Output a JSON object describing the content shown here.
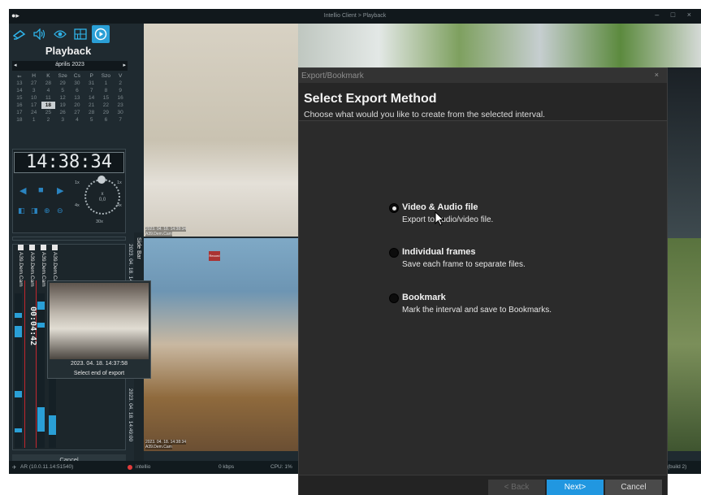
{
  "window": {
    "title": "Intellio Client > Playback",
    "controls": "–  □  ×"
  },
  "left_panel": {
    "toolbar_icons": [
      "camera-icon",
      "speaker-icon",
      "eye-icon",
      "layout-icon",
      "playback-icon"
    ],
    "title": "Playback",
    "calendar": {
      "month": "április 2023",
      "prev": "◂",
      "next": "▸",
      "weekdays": [
        "⇐",
        "H",
        "K",
        "Sze",
        "Cs",
        "P",
        "Szo",
        "V"
      ],
      "rows": [
        [
          "13",
          "27",
          "28",
          "29",
          "30",
          "31",
          "1",
          "2"
        ],
        [
          "14",
          "3",
          "4",
          "5",
          "6",
          "7",
          "8",
          "9"
        ],
        [
          "15",
          "10",
          "11",
          "12",
          "13",
          "14",
          "15",
          "16"
        ],
        [
          "16",
          "17",
          "18",
          "19",
          "20",
          "21",
          "22",
          "23"
        ],
        [
          "17",
          "24",
          "25",
          "26",
          "27",
          "28",
          "29",
          "30"
        ],
        [
          "18",
          "1",
          "2",
          "3",
          "4",
          "5",
          "6",
          "7"
        ]
      ],
      "selected_day": "18"
    },
    "time": "14:38:34",
    "speed": {
      "center": "x 0,0",
      "labels": [
        "1x",
        "1x",
        "4x",
        "4x",
        "30x"
      ]
    },
    "cameras": [
      "A39.Dem.Cam",
      "A39.Dem.Cam",
      "A39.Dem.Cam",
      "A39.Dem.Cam"
    ],
    "duration": "00:04:42",
    "cancel_label": "Cancel"
  },
  "preview": {
    "timestamp": "2023. 04. 18. 14:37:58",
    "hint": "Select end of export"
  },
  "video": {
    "sidebar_label": "Side Bar",
    "cam1_ts": "2023. 04. 18. 14:38:34",
    "cam1_name": "A39.Dem.Cam",
    "cam1_vertical_ts": "2023. 04. 18. 14:28:00",
    "cam2_ts": "2023. 04. 18. 14:38:34",
    "cam2_name": "A39.Dem.Cam",
    "cam2_vertical_ts": "2023. 04. 18. 14:49:00",
    "cam2_badge": "Record"
  },
  "status_bar": {
    "connection": "AR (10.0.11.14:51540)",
    "server": "intellio",
    "bandwidth": "0 kbps",
    "cpu": "CPU: 1%",
    "version": "5.3 (build 2)"
  },
  "dialog": {
    "title": "Export/Bookmark",
    "close": "×",
    "heading": "Select Export Method",
    "subtitle": "Choose what would you like to create from the selected interval.",
    "options": [
      {
        "label": "Video & Audio file",
        "desc": "Export to audio/video file.",
        "selected": true
      },
      {
        "label": "Individual frames",
        "desc": "Save each frame to separate files.",
        "selected": false
      },
      {
        "label": "Bookmark",
        "desc": "Mark the interval and save to Bookmarks.",
        "selected": false
      }
    ],
    "buttons": {
      "back": "< Back",
      "next": "Next>",
      "cancel": "Cancel"
    }
  }
}
